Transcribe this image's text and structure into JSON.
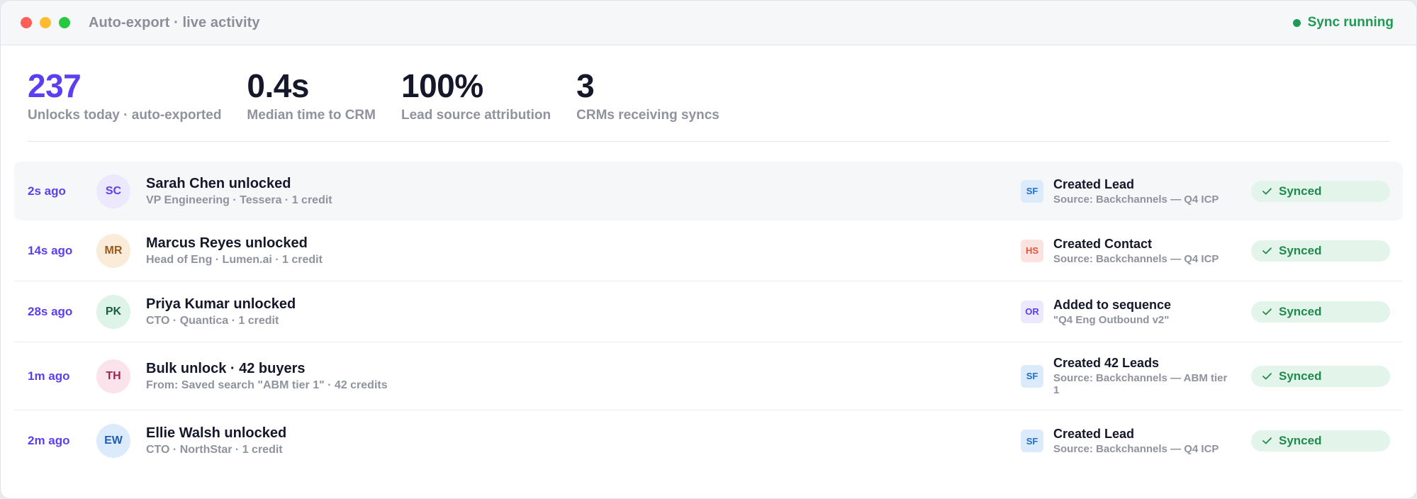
{
  "window": {
    "title": "Auto-export · live activity",
    "status": "Sync running",
    "colors": {
      "close": "#ff5f57",
      "minimize": "#febc2e",
      "maximize": "#28c840",
      "status": "#1f9a55",
      "accent": "#5b3ff0"
    }
  },
  "stats": [
    {
      "value": "237",
      "label": "Unlocks today · auto-exported",
      "color": "#5b3ff0"
    },
    {
      "value": "0.4s",
      "label": "Median time to CRM",
      "color": "#15172a"
    },
    {
      "value": "100%",
      "label": "Lead source attribution",
      "color": "#15172a"
    },
    {
      "value": "3",
      "label": "CRMs receiving syncs",
      "color": "#15172a"
    }
  ],
  "activity": [
    {
      "time": "2s ago",
      "initials": "SC",
      "avatar_bg": "#ece8fd",
      "avatar_fg": "#5b3ff0",
      "name": "Sarah Chen unlocked",
      "meta": "VP Engineering · Tessera · 1 credit",
      "crm": "SF",
      "crm_bg": "#dcebfb",
      "crm_fg": "#1f6fc9",
      "action": "Created Lead",
      "source": "Source: Backchannels — Q4 ICP",
      "status": "Synced"
    },
    {
      "time": "14s ago",
      "initials": "MR",
      "avatar_bg": "#fbebd9",
      "avatar_fg": "#9a5a1e",
      "name": "Marcus Reyes unlocked",
      "meta": "Head of Eng · Lumen.ai · 1 credit",
      "crm": "HS",
      "crm_bg": "#fde3df",
      "crm_fg": "#e0553f",
      "action": "Created Contact",
      "source": "Source: Backchannels — Q4 ICP",
      "status": "Synced"
    },
    {
      "time": "28s ago",
      "initials": "PK",
      "avatar_bg": "#def4e8",
      "avatar_fg": "#1b5e3b",
      "name": "Priya Kumar unlocked",
      "meta": "CTO · Quantica · 1 credit",
      "crm": "OR",
      "crm_bg": "#ece8fd",
      "crm_fg": "#5b3ff0",
      "action": "Added to sequence",
      "source": "\"Q4 Eng Outbound v2\"",
      "status": "Synced"
    },
    {
      "time": "1m ago",
      "initials": "TH",
      "avatar_bg": "#fbe3ec",
      "avatar_fg": "#9c2451",
      "name": "Bulk unlock · 42 buyers",
      "meta": "From: Saved search \"ABM tier 1\" · 42 credits",
      "crm": "SF",
      "crm_bg": "#dcebfb",
      "crm_fg": "#1f6fc9",
      "action": "Created 42 Leads",
      "source": "Source: Backchannels — ABM tier 1",
      "status": "Synced"
    },
    {
      "time": "2m ago",
      "initials": "EW",
      "avatar_bg": "#dcebfb",
      "avatar_fg": "#1f5fb0",
      "name": "Ellie Walsh unlocked",
      "meta": "CTO · NorthStar · 1 credit",
      "crm": "SF",
      "crm_bg": "#dcebfb",
      "crm_fg": "#1f6fc9",
      "action": "Created Lead",
      "source": "Source: Backchannels — Q4 ICP",
      "status": "Synced"
    }
  ]
}
